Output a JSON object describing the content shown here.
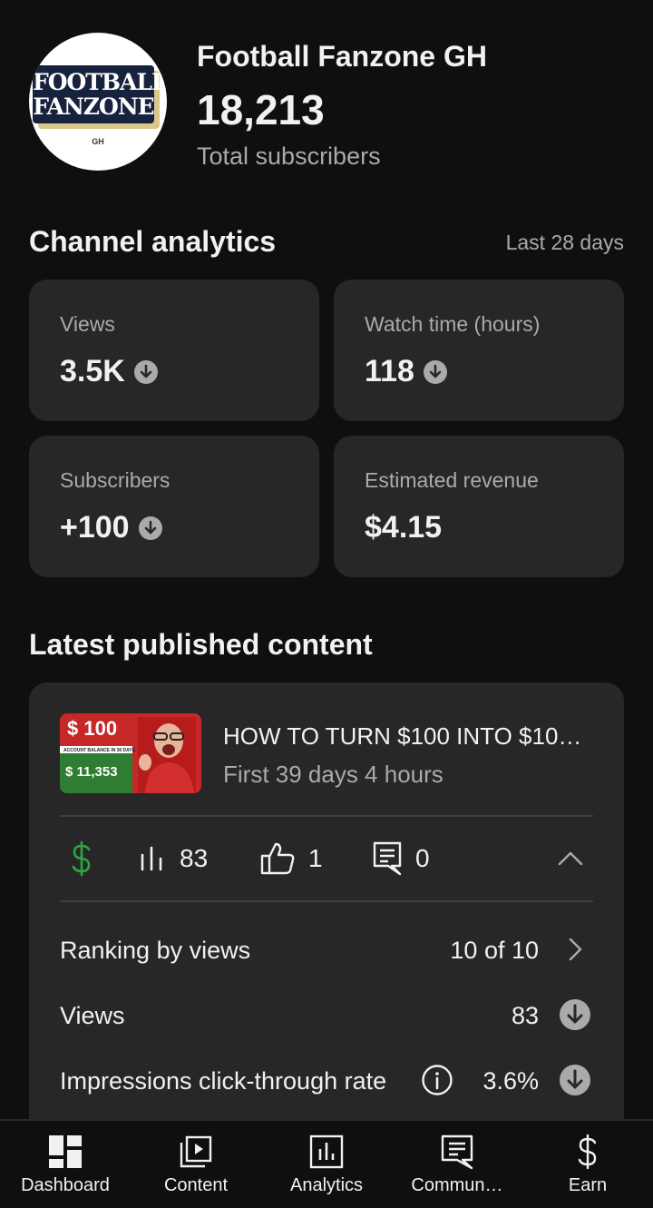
{
  "channel": {
    "name": "Football Fanzone GH",
    "subscriber_count": "18,213",
    "subscriber_label": "Total subscribers",
    "logo_lines": [
      "FOOTBALL",
      "FANZONE",
      "GH"
    ]
  },
  "analytics": {
    "title": "Channel analytics",
    "period": "Last 28 days",
    "metrics": [
      {
        "label": "Views",
        "value": "3.5K",
        "trend": "down"
      },
      {
        "label": "Watch time (hours)",
        "value": "118",
        "trend": "down"
      },
      {
        "label": "Subscribers",
        "value": "+100",
        "trend": "down"
      },
      {
        "label": "Estimated revenue",
        "value": "$4.15",
        "trend": "none"
      }
    ]
  },
  "latest": {
    "title": "Latest published content",
    "video": {
      "title": "HOW TO TURN $100 INTO $10…",
      "subtitle": "First 39 days 4 hours",
      "thumbnail_text": {
        "top": "$ 100",
        "middle": "ACCOUNT BALANCE IN 30 DAYS",
        "bottom": "$ 11,353"
      },
      "stats": {
        "views": "83",
        "likes": "1",
        "comments": "0"
      }
    },
    "rows": [
      {
        "label": "Ranking by views",
        "value": "10 of 10",
        "end_icon": "chevron-right-icon"
      },
      {
        "label": "Views",
        "value": "83",
        "end_icon": "down-arrow-circle-icon"
      },
      {
        "label": "Impressions click-through rate",
        "value": "3.6%",
        "end_icon": "down-arrow-circle-icon"
      }
    ]
  },
  "nav": [
    {
      "label": "Dashboard",
      "icon": "dashboard-icon"
    },
    {
      "label": "Content",
      "icon": "content-icon"
    },
    {
      "label": "Analytics",
      "icon": "analytics-icon"
    },
    {
      "label": "Commun…",
      "icon": "community-icon"
    },
    {
      "label": "Earn",
      "icon": "earn-icon"
    }
  ],
  "colors": {
    "background": "#0f0f0f",
    "card": "#272727",
    "secondary_text": "#aaaaaa",
    "money_green": "#2ba640"
  }
}
